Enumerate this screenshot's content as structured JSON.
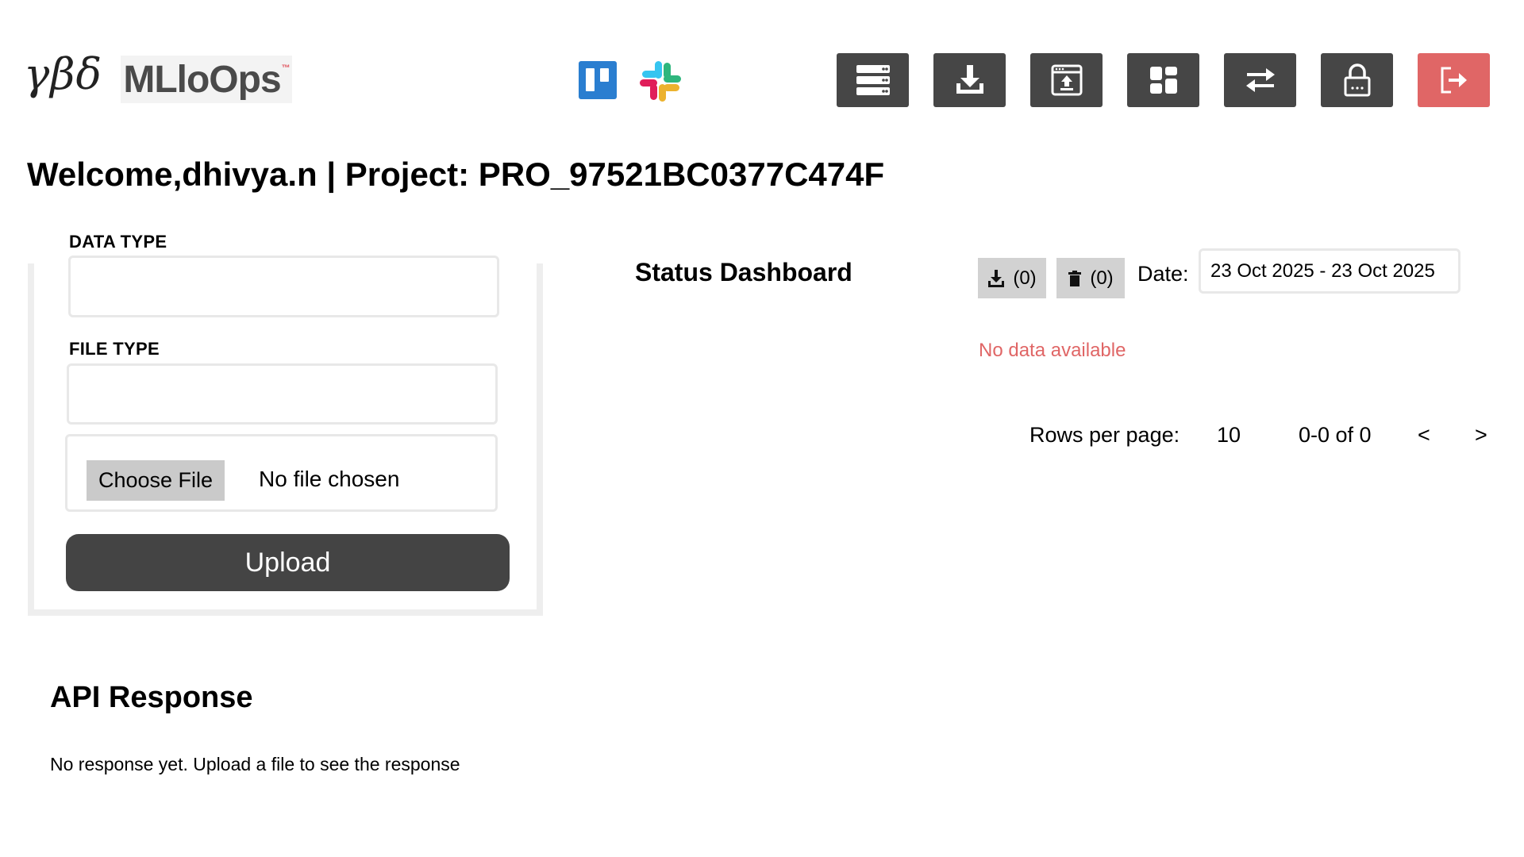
{
  "header": {
    "logo_greek": "γβδ",
    "brand": "MLloOps",
    "brand_tm": "™",
    "integrations": [
      {
        "name": "trello-icon"
      },
      {
        "name": "slack-icon"
      }
    ],
    "toolbar": [
      {
        "icon": "database-icon"
      },
      {
        "icon": "download-icon"
      },
      {
        "icon": "upload-window-icon"
      },
      {
        "icon": "dashboard-icon"
      },
      {
        "icon": "transfer-icon"
      },
      {
        "icon": "lock-icon"
      },
      {
        "icon": "logout-icon",
        "color": "#e06666"
      }
    ]
  },
  "welcome": "Welcome,dhivya.n | Project: PRO_97521BC0377C474F",
  "upload_form": {
    "data_type_label": "DATA TYPE",
    "data_type_value": "",
    "file_type_label": "FILE TYPE",
    "file_type_value": "",
    "choose_file_label": "Choose File",
    "no_file_text": "No file chosen",
    "upload_label": "Upload"
  },
  "status_dashboard": {
    "title": "Status Dashboard",
    "download_count": "(0)",
    "delete_count": "(0)",
    "date_label": "Date:",
    "date_range": "23 Oct 2025 - 23 Oct 2025",
    "no_data": "No data available",
    "rows_per_page_label": "Rows per page:",
    "rows_per_page_value": "10",
    "range_text": "0-0 of 0",
    "prev": "<",
    "next": ">"
  },
  "api_response": {
    "title": "API Response",
    "message": "No response yet. Upload a file to see the response"
  },
  "colors": {
    "toolbar_bg": "#464646",
    "logout_bg": "#e06666",
    "upload_bg": "#444444",
    "no_data": "#e06666",
    "trello": "#2a7ed0"
  }
}
